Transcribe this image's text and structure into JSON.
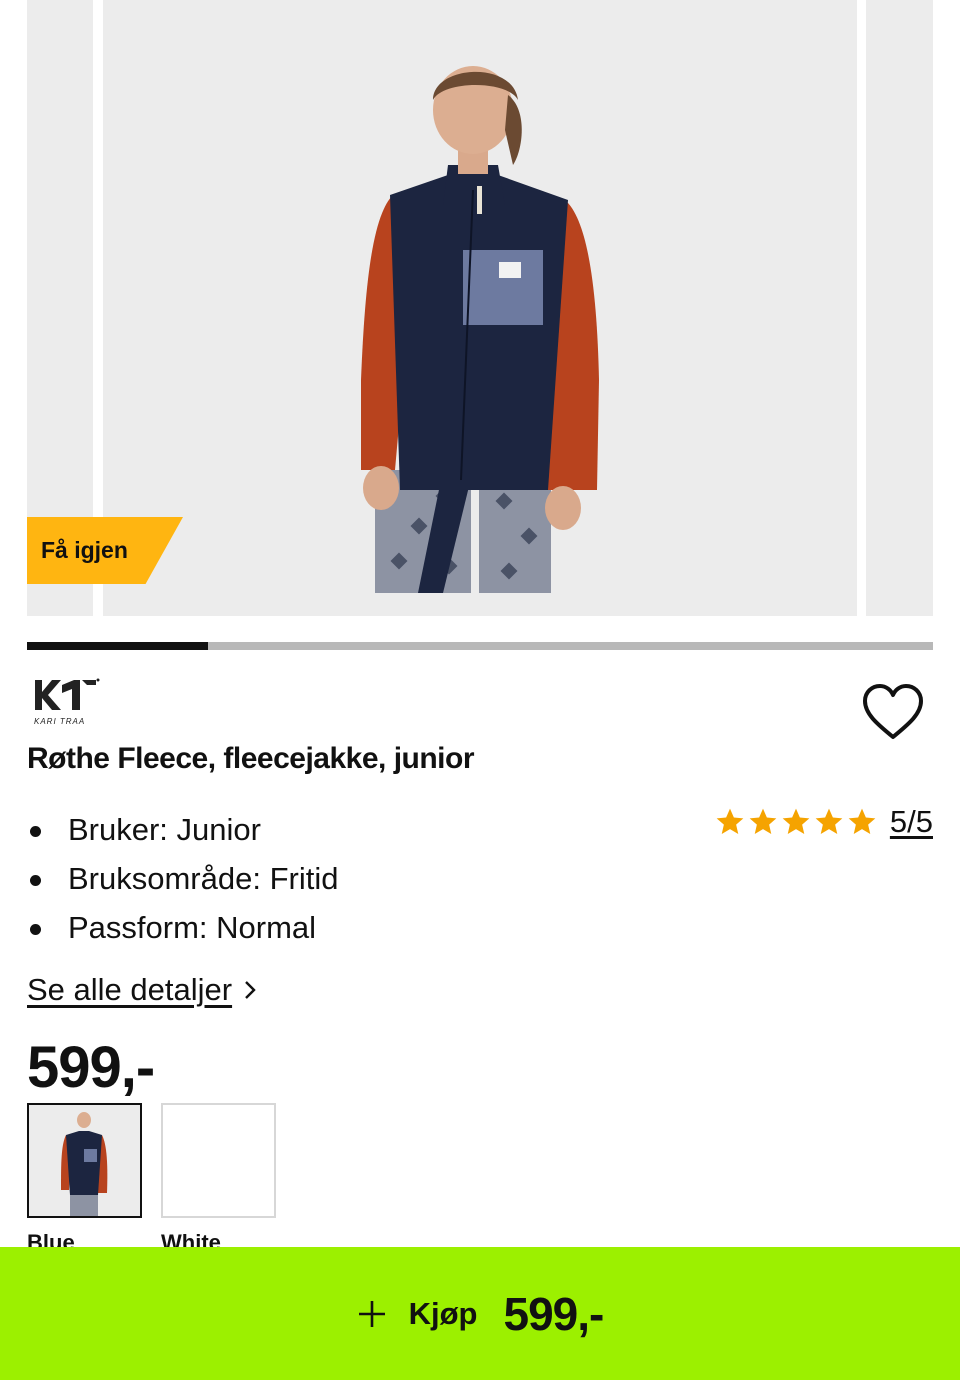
{
  "gallery": {
    "badge": "Få igjen",
    "slide_progress": 0.2,
    "image_name": "product-photo-fleece-jacket"
  },
  "product": {
    "brand_logo_text": "KARI TRAA",
    "title": "Røthe Fleece, fleecejakke, junior",
    "bullets": [
      "Bruker: Junior",
      "Bruksområde: Fritid",
      "Passform: Normal"
    ],
    "rating": {
      "stars": 5,
      "max": 5,
      "label": "5/5",
      "star_color": "#f5a300"
    },
    "details_link": "Se alle detaljer",
    "price": "599,-"
  },
  "variants": [
    {
      "label": "Blue",
      "selected": true
    },
    {
      "label": "White",
      "selected": false
    }
  ],
  "buy_bar": {
    "label": "Kjøp",
    "price": "599,-",
    "color": "#9cf000",
    "icon": "plus-icon"
  },
  "colors": {
    "badge": "#ffb511",
    "navy": "#1c2540",
    "orange": "#b8431e"
  }
}
